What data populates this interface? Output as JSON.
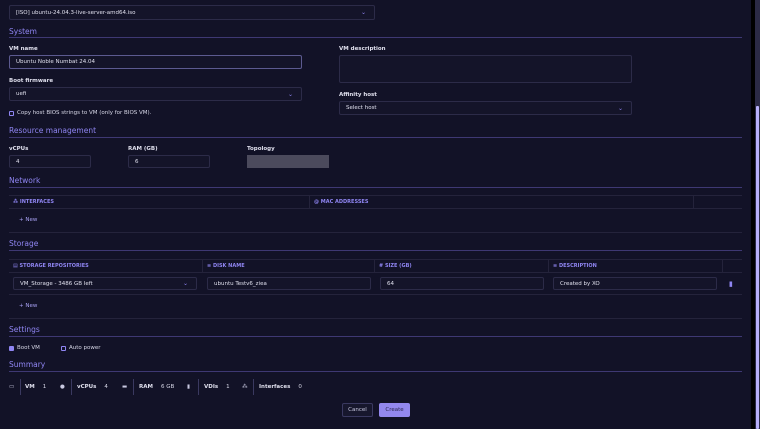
{
  "iso": {
    "value": "[ISO] ubuntu-24.04.3-live-server-amd64.iso"
  },
  "system": {
    "title": "System",
    "vm_name_label": "VM name",
    "vm_name": "Ubuntu Noble Numbat 24.04",
    "boot_firmware_label": "Boot firmware",
    "boot_firmware": "uefi",
    "copy_bios": "Copy host BIOS strings to VM (only for BIOS VM).",
    "vm_description_label": "VM description",
    "vm_description": "",
    "affinity_host_label": "Affinity host",
    "affinity_host": "Select host"
  },
  "resources": {
    "title": "Resource management",
    "vcpus_label": "vCPUs",
    "vcpus": "4",
    "ram_label": "RAM (GB)",
    "ram": "6",
    "topology_label": "Topology"
  },
  "network": {
    "title": "Network",
    "columns": [
      "INTERFACES",
      "MAC ADDRESSES"
    ],
    "new_label": "+ New"
  },
  "storage": {
    "title": "Storage",
    "columns": [
      "STORAGE REPOSITORIES",
      "DISK NAME",
      "SIZE (GB)",
      "DESCRIPTION"
    ],
    "rows": [
      {
        "sr": "VM_Storage - 3486 GB left",
        "name": "ubuntu Testv6_ziea",
        "size": "64",
        "description": "Created by XO"
      }
    ],
    "new_label": "+ New"
  },
  "settings": {
    "title": "Settings",
    "boot_vm": "Boot VM",
    "boot_vm_checked": true,
    "auto_power": "Auto power",
    "auto_power_checked": false
  },
  "summary": {
    "title": "Summary",
    "vm_label": "VM",
    "vm": "1",
    "vcpus_label": "vCPUs",
    "vcpus": "4",
    "ram_label": "RAM",
    "ram": "6 GB",
    "vdis_label": "VDIs",
    "vdis": "1",
    "interfaces_label": "Interfaces",
    "interfaces": "0"
  },
  "actions": {
    "cancel": "Cancel",
    "create": "Create"
  },
  "colors": {
    "accent": "#8f85f2",
    "background": "#121227"
  }
}
